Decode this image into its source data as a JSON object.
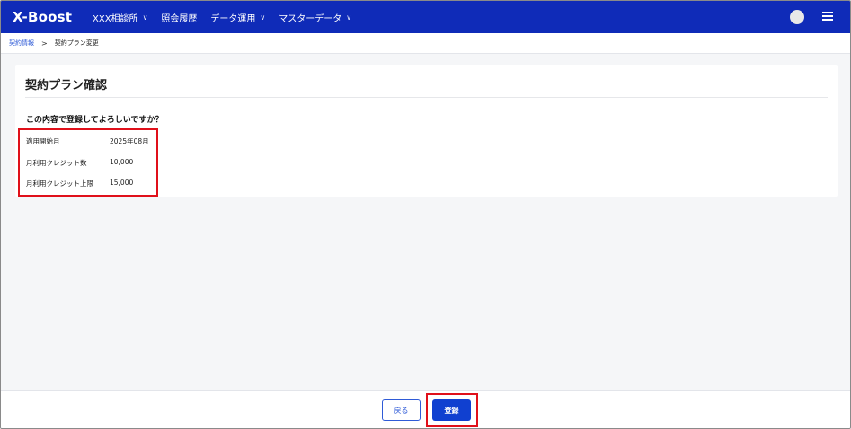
{
  "header": {
    "logo_text": "X-Boost",
    "nav": [
      {
        "label": "XXX相談所",
        "dropdown": true
      },
      {
        "label": "照会履歴",
        "dropdown": false
      },
      {
        "label": "データ運用",
        "dropdown": true
      },
      {
        "label": "マスターデータ",
        "dropdown": true
      }
    ],
    "accent_color": "#0f2bb8"
  },
  "breadcrumb": {
    "parent": "契約情報",
    "separator": ">",
    "current": "契約プラン変更"
  },
  "card": {
    "title": "契約プラン確認",
    "question": "この内容で登録してよろしいですか？",
    "rows": [
      {
        "label": "適用開始月",
        "value": "2025年08月"
      },
      {
        "label": "月利用クレジット数",
        "value": "10,000"
      },
      {
        "label": "月利用クレジット上限",
        "value": "15,000"
      }
    ]
  },
  "footer": {
    "back_label": "戻る",
    "register_label": "登録"
  },
  "highlight_color": "#e0101a"
}
